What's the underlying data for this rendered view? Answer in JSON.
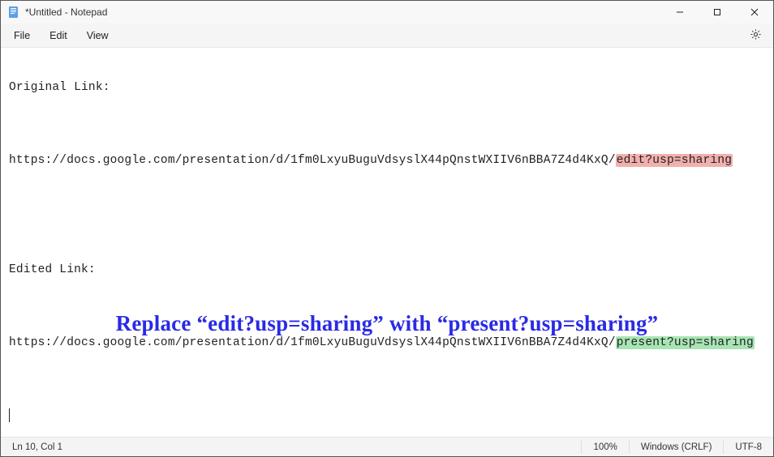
{
  "window": {
    "title": "*Untitled - Notepad"
  },
  "menu": {
    "file": "File",
    "edit": "Edit",
    "view": "View"
  },
  "content": {
    "heading1": "Original Link:",
    "url_prefix": "https://docs.google.com/presentation/d/1fm0LxyuBuguVdsyslX44pQnstWXIIV6nBBA7Z4d4KxQ/",
    "original_suffix": "edit?usp=sharing",
    "heading2": "Edited Link:",
    "edited_suffix": "present?usp=sharing"
  },
  "annotation": {
    "text": "Replace “edit?usp=sharing” with “present?usp=sharing”"
  },
  "status": {
    "position": "Ln 10, Col 1",
    "zoom": "100%",
    "line_ending": "Windows (CRLF)",
    "encoding": "UTF-8"
  },
  "colors": {
    "highlight_red": "#f2b0ad",
    "highlight_green": "#a8e5b4",
    "annotation_blue": "#2a2ae6"
  }
}
